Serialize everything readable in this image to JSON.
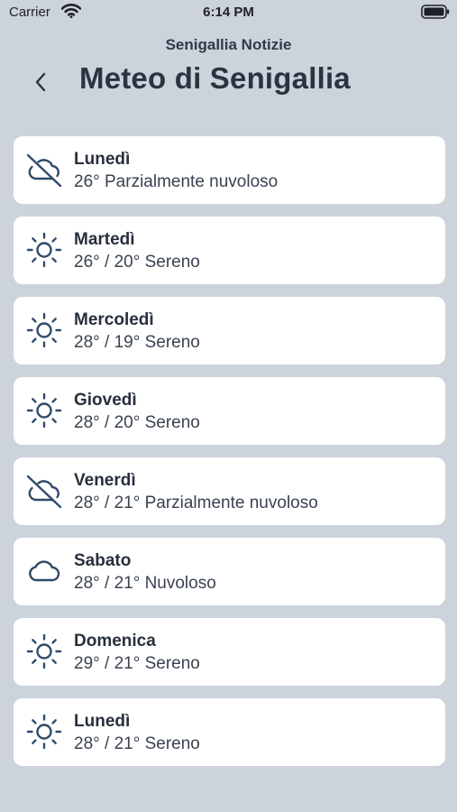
{
  "status_bar": {
    "carrier": "Carrier",
    "time": "6:14 PM"
  },
  "nav": {
    "subtitle": "Senigallia Notizie",
    "title": "Meteo di Senigallia",
    "back_icon": "chevron-left-icon"
  },
  "colors": {
    "background": "#ccd3db",
    "card": "#ffffff",
    "icon": "#2f4a6b",
    "text": "#2b3340"
  },
  "forecast": [
    {
      "day": "Lunedì",
      "detail": "26° Parzialmente nuvoloso",
      "icon": "cloud-off-icon"
    },
    {
      "day": "Martedì",
      "detail": "26° / 20° Sereno",
      "icon": "sun-icon"
    },
    {
      "day": "Mercoledì",
      "detail": "28° / 19° Sereno",
      "icon": "sun-icon"
    },
    {
      "day": "Giovedì",
      "detail": "28° / 20° Sereno",
      "icon": "sun-icon"
    },
    {
      "day": "Venerdì",
      "detail": "28° / 21° Parzialmente nuvoloso",
      "icon": "cloud-off-icon"
    },
    {
      "day": "Sabato",
      "detail": "28° / 21° Nuvoloso",
      "icon": "cloud-icon"
    },
    {
      "day": "Domenica",
      "detail": "29° / 21° Sereno",
      "icon": "sun-icon"
    },
    {
      "day": "Lunedì",
      "detail": "28° / 21° Sereno",
      "icon": "sun-icon"
    }
  ]
}
